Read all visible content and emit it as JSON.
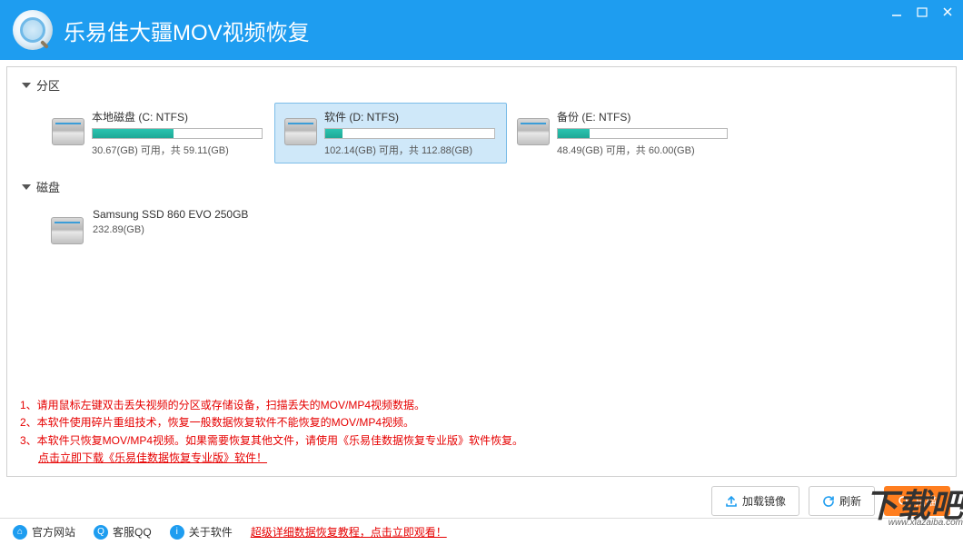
{
  "header": {
    "title": "乐易佳大疆MOV视频恢复"
  },
  "sections": {
    "partition": {
      "label": "分区",
      "drives": [
        {
          "label": "本地磁盘 (C: NTFS)",
          "used_pct": 48,
          "stats": "30.67(GB) 可用，共 59.11(GB)",
          "selected": false
        },
        {
          "label": "软件 (D: NTFS)",
          "used_pct": 10,
          "stats": "102.14(GB) 可用，共 112.88(GB)",
          "selected": true
        },
        {
          "label": "备份 (E: NTFS)",
          "used_pct": 19,
          "stats": "48.49(GB) 可用，共 60.00(GB)",
          "selected": false
        }
      ]
    },
    "disk": {
      "label": "磁盘",
      "disks": [
        {
          "label": "Samsung SSD 860 EVO 250GB",
          "size": "232.89(GB)"
        }
      ]
    }
  },
  "instructions": {
    "line1": "1、请用鼠标左键双击丢失视频的分区或存储设备，扫描丢失的MOV/MP4视频数据。",
    "line2": "2、本软件使用碎片重组技术，恢复一般数据恢复软件不能恢复的MOV/MP4视频。",
    "line3": "3、本软件只恢复MOV/MP4视频。如果需要恢复其他文件，请使用《乐易佳数据恢复专业版》软件恢复。",
    "link": "点击立即下载《乐易佳数据恢复专业版》软件！"
  },
  "toolbar": {
    "load_image": "加载镜像",
    "refresh": "刷新",
    "scan": "扫描"
  },
  "footer": {
    "official_site": "官方网站",
    "support_qq": "客服QQ",
    "about": "关于软件",
    "tutorial": "超级详细数据恢复教程，点击立即观看！"
  },
  "watermark": {
    "main": "下载吧",
    "sub": "www.xiazaiba.com"
  }
}
